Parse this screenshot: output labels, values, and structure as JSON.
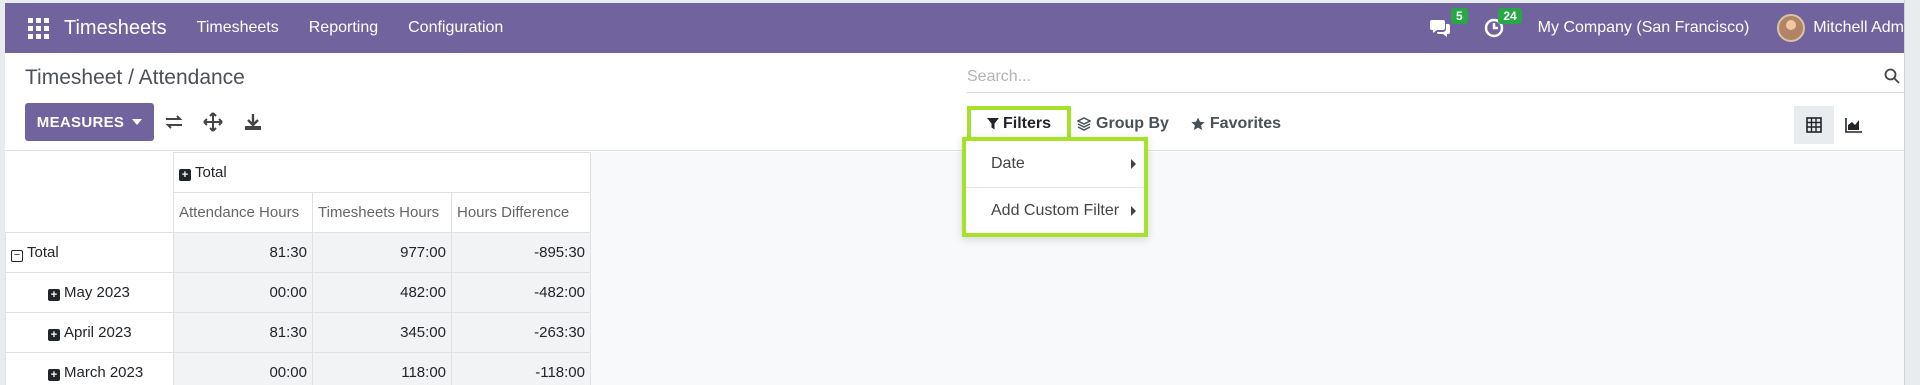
{
  "navbar": {
    "app_title": "Timesheets",
    "menu": [
      "Timesheets",
      "Reporting",
      "Configuration"
    ],
    "messages_count": "5",
    "activities_count": "24",
    "company": "My Company (San Francisco)",
    "user": "Mitchell Adm",
    "bg_color": "#71639e",
    "badge_color": "#28a745"
  },
  "control_panel": {
    "breadcrumb": "Timesheet / Attendance",
    "search_placeholder": "Search...",
    "measures_label": "MEASURES",
    "filters_label": "Filters",
    "group_by_label": "Group By",
    "favorites_label": "Favorites",
    "highlight_color": "#a7e22b"
  },
  "filter_dropdown": {
    "items": [
      "Date",
      "Add Custom Filter"
    ]
  },
  "pivot": {
    "col_group": "Total",
    "measures": [
      "Attendance Hours",
      "Timesheets Hours",
      "Hours Difference"
    ],
    "rows": [
      {
        "label": "Total",
        "values": [
          "81:30",
          "977:00",
          "-895:30"
        ]
      },
      {
        "label": "May 2023",
        "values": [
          "00:00",
          "482:00",
          "-482:00"
        ]
      },
      {
        "label": "April 2023",
        "values": [
          "81:30",
          "345:00",
          "-263:30"
        ]
      },
      {
        "label": "March 2023",
        "values": [
          "00:00",
          "118:00",
          "-118:00"
        ]
      }
    ]
  }
}
